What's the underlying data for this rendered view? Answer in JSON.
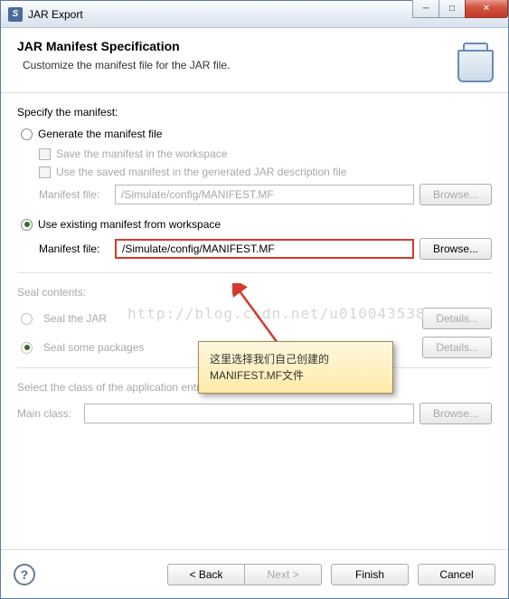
{
  "titlebar": {
    "text": "JAR Export"
  },
  "header": {
    "title": "JAR Manifest Specification",
    "subtitle": "Customize the manifest file for the JAR file."
  },
  "manifest": {
    "section_label": "Specify the manifest:",
    "generate": {
      "label": "Generate the manifest file",
      "save_chk": "Save the manifest in the workspace",
      "use_saved_chk": "Use the saved manifest in the generated JAR description file",
      "field_label": "Manifest file:",
      "field_value": "/Simulate/config/MANIFEST.MF",
      "browse": "Browse..."
    },
    "existing": {
      "label": "Use existing manifest from workspace",
      "field_label": "Manifest file:",
      "field_value": "/Simulate/config/MANIFEST.MF",
      "browse": "Browse..."
    }
  },
  "seal": {
    "section_label": "Seal contents:",
    "jar": {
      "label": "Seal the JAR",
      "btn": "Details..."
    },
    "pkg": {
      "label": "Seal some packages",
      "btn": "Details..."
    }
  },
  "entry": {
    "section_label": "Select the class of the application entry point:",
    "field_label": "Main class:",
    "field_value": "",
    "browse": "Browse..."
  },
  "watermark": "http://blog.csdn.net/u010043538",
  "callout": "这里选择我们自己创建的MANIFEST.MF文件",
  "footer": {
    "back": "< Back",
    "next": "Next >",
    "finish": "Finish",
    "cancel": "Cancel"
  }
}
